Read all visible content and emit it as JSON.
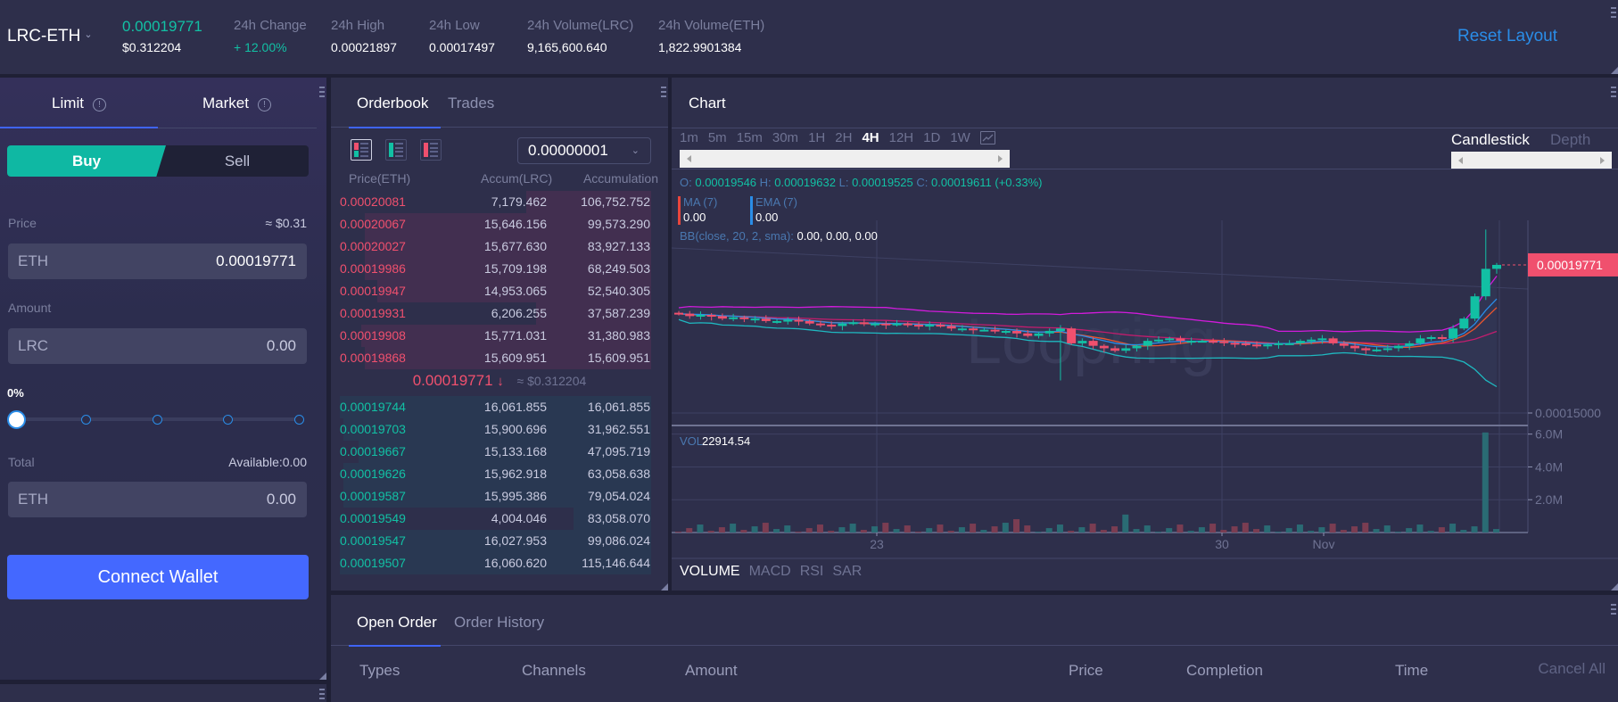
{
  "ticker": {
    "pair": "LRC-ETH",
    "last_price": "0.00019771",
    "last_price_usd": "$0.312204",
    "stats": [
      {
        "label": "24h Change",
        "value": "+ 12.00%",
        "positive": true
      },
      {
        "label": "24h High",
        "value": "0.00021897"
      },
      {
        "label": "24h Low",
        "value": "0.00017497"
      },
      {
        "label": "24h Volume(LRC)",
        "value": "9,165,600.640"
      },
      {
        "label": "24h Volume(ETH)",
        "value": "1,822.9901384"
      }
    ],
    "reset_layout": "Reset Layout"
  },
  "order_form": {
    "tabs": [
      {
        "label": "Limit",
        "active": true
      },
      {
        "label": "Market",
        "active": false
      }
    ],
    "info_glyph": "!",
    "buy_label": "Buy",
    "sell_label": "Sell",
    "price_label": "Price",
    "price_usd": "≈ $0.31",
    "price_unit": "ETH",
    "price_value": "0.00019771",
    "amount_label": "Amount",
    "amount_unit": "LRC",
    "amount_value": "0.00",
    "percent_label": "0%",
    "percent_value": 0,
    "slider_stops": [
      0,
      25,
      50,
      75,
      100
    ],
    "total_label": "Total",
    "available": "Available:0.00",
    "total_unit": "ETH",
    "total_value": "0.00",
    "connect_wallet": "Connect Wallet"
  },
  "orderbook": {
    "tabs": [
      {
        "label": "Orderbook",
        "active": true
      },
      {
        "label": "Trades",
        "active": false
      }
    ],
    "precision": "0.00000001",
    "headers": {
      "price": "Price(ETH)",
      "amount": "Accum(LRC)",
      "total": "Accumulation"
    },
    "asks": [
      {
        "price": "0.00020081",
        "amount": "7,179.462",
        "total": "106,752.752",
        "depth": 0.4
      },
      {
        "price": "0.00020067",
        "amount": "15,646.156",
        "total": "99,573.290",
        "depth": 0.92
      },
      {
        "price": "0.00020027",
        "amount": "15,677.630",
        "total": "83,927.133",
        "depth": 0.92
      },
      {
        "price": "0.00019986",
        "amount": "15,709.198",
        "total": "68,249.503",
        "depth": 0.92
      },
      {
        "price": "0.00019947",
        "amount": "14,953.065",
        "total": "52,540.305",
        "depth": 0.88
      },
      {
        "price": "0.00019931",
        "amount": "6,206.255",
        "total": "37,587.239",
        "depth": 0.37
      },
      {
        "price": "0.00019908",
        "amount": "15,771.031",
        "total": "31,380.983",
        "depth": 0.93
      },
      {
        "price": "0.00019868",
        "amount": "15,609.951",
        "total": "15,609.951",
        "depth": 0.92
      }
    ],
    "mid_price": "0.00019771",
    "mid_arrow": "↓",
    "mid_usd": "≈ $0.312204",
    "bids": [
      {
        "price": "0.00019744",
        "amount": "16,061.855",
        "total": "16,061.855",
        "depth": 1.0
      },
      {
        "price": "0.00019703",
        "amount": "15,900.696",
        "total": "31,962.551",
        "depth": 0.99
      },
      {
        "price": "0.00019667",
        "amount": "15,133.168",
        "total": "47,095.719",
        "depth": 0.94
      },
      {
        "price": "0.00019626",
        "amount": "15,962.918",
        "total": "63,058.638",
        "depth": 0.99
      },
      {
        "price": "0.00019587",
        "amount": "15,995.386",
        "total": "79,054.024",
        "depth": 0.99
      },
      {
        "price": "0.00019549",
        "amount": "4,004.046",
        "total": "83,058.070",
        "depth": 0.25
      },
      {
        "price": "0.00019547",
        "amount": "16,027.953",
        "total": "99,086.024",
        "depth": 1.0
      },
      {
        "price": "0.00019507",
        "amount": "16,060.620",
        "total": "115,146.644",
        "depth": 1.0
      }
    ]
  },
  "chart": {
    "title": "Chart",
    "timeframes": [
      "1m",
      "5m",
      "15m",
      "30m",
      "1H",
      "2H",
      "4H",
      "12H",
      "1D",
      "1W"
    ],
    "active_timeframe": "4H",
    "chart_types": [
      {
        "label": "Candlestick",
        "active": true
      },
      {
        "label": "Depth",
        "active": false
      }
    ],
    "ohlc": {
      "o_label": "O:",
      "o": "0.00019546",
      "h_label": "H:",
      "h": "0.00019632",
      "l_label": "L:",
      "l": "0.00019525",
      "c_label": "C:",
      "c": "0.00019611",
      "chg": "(+0.33%)"
    },
    "ma_label": "MA (7)",
    "ma_value": "0.00",
    "ema_label": "EMA (7)",
    "ema_value": "0.00",
    "bb_label": "BB(close, 20, 2, sma):",
    "bb_value": "0.00, 0.00, 0.00",
    "watermark": "Loopring",
    "price_tag": "0.00019771",
    "price_axis_label": "0.00015000",
    "vol_label": "VOL",
    "vol_value": "22914.54",
    "vol_axis": [
      "6.0M",
      "4.0M",
      "2.0M"
    ],
    "x_labels": [
      "23",
      "30",
      "Nov"
    ],
    "indicators": [
      {
        "label": "VOLUME",
        "active": true
      },
      {
        "label": "MACD",
        "active": false
      },
      {
        "label": "RSI",
        "active": false
      },
      {
        "label": "SAR",
        "active": false
      }
    ],
    "colors": {
      "up": "#12c0a4",
      "down": "#f0506e",
      "ma": "#e8552f",
      "ema": "#2a8de8",
      "bb_upper": "#d21bdc",
      "bb_mid": "#c21d6e",
      "bb_lower": "#1fb8c0"
    }
  },
  "chart_data": {
    "type": "candlestick",
    "title": "LRC-ETH 4H",
    "price_axis": {
      "labeled_tick": 0.00015,
      "last": 0.00019771
    },
    "x_ticks": [
      "23",
      "30",
      "Nov"
    ],
    "closes": [
      0.000178,
      0.000177,
      0.0001775,
      0.000177,
      0.000176,
      0.0001765,
      0.000176,
      0.000176,
      0.000175,
      0.000175,
      0.0001755,
      0.000175,
      0.000174,
      0.0001735,
      0.000173,
      0.000174,
      0.0001745,
      0.000174,
      0.000174,
      0.0001735,
      0.000174,
      0.0001735,
      0.000173,
      0.0001735,
      0.000173,
      0.000172,
      0.000172,
      0.0001715,
      0.0001715,
      0.000171,
      0.000171,
      0.00017,
      0.000169,
      0.00017,
      0.000171,
      0.000172,
      0.000166,
      0.000167,
      0.000165,
      0.000164,
      0.000163,
      0.000164,
      0.000165,
      0.000167,
      0.0001675,
      0.000168,
      0.000167,
      0.000167,
      0.000167,
      0.0001668,
      0.0001662,
      0.000166,
      0.0001655,
      0.000165,
      0.0001655,
      0.000166,
      0.000166,
      0.000167,
      0.0001675,
      0.000168,
      0.000166,
      0.000165,
      0.000164,
      0.0001632,
      0.0001635,
      0.000164,
      0.000165,
      0.000166,
      0.000168,
      0.0001685,
      0.000168,
      0.000172,
      0.000176,
      0.000185,
      0.00019611,
      0.00019771
    ],
    "volume": {
      "unit": "M",
      "axis": [
        2.0,
        4.0,
        6.0
      ],
      "last": 22914.54,
      "peak": 6.1
    }
  },
  "orders": {
    "tabs": [
      {
        "label": "Open Order",
        "active": true
      },
      {
        "label": "Order History",
        "active": false
      }
    ],
    "columns": [
      "Types",
      "Channels",
      "Amount",
      "Price",
      "Completion",
      "Time"
    ],
    "cancel_all": "Cancel All"
  }
}
